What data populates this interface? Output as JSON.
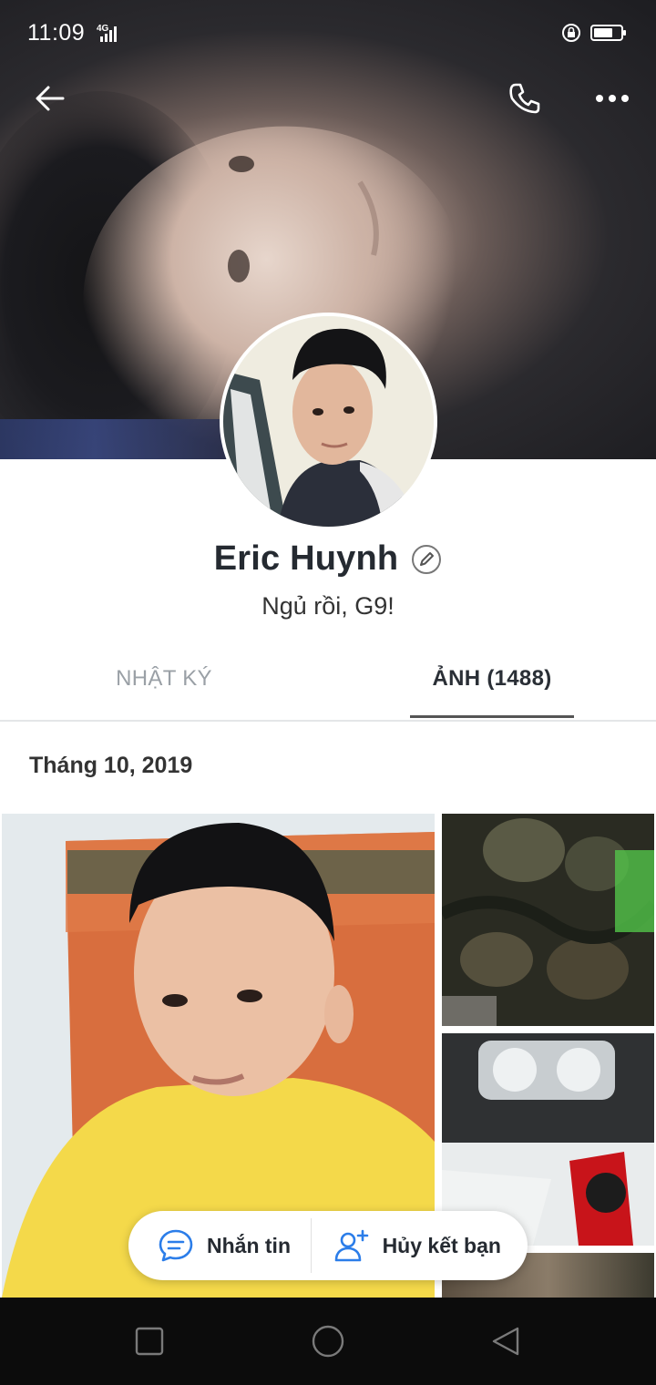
{
  "status_bar": {
    "time": "11:09",
    "network": "4G"
  },
  "profile": {
    "name": "Eric Huynh",
    "status": "Ngủ rồi, G9!"
  },
  "tabs": [
    {
      "label": "NHẬT KÝ",
      "active": false
    },
    {
      "label": "ẢNH (1488)",
      "active": true
    }
  ],
  "photos_section": {
    "month_label": "Tháng 10, 2019"
  },
  "actions": {
    "message_label": "Nhắn tin",
    "unfriend_label": "Hủy kết bạn"
  },
  "colors": {
    "accent": "#1a73e8",
    "icon_blue": "#2b7de9"
  }
}
